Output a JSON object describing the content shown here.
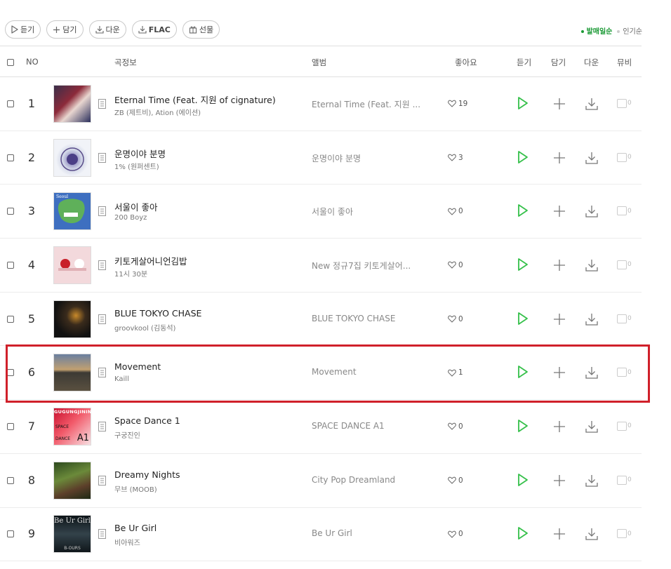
{
  "toolbar": {
    "listen_label": "듣기",
    "add_label": "담기",
    "download_label": "다운",
    "flac_label": "FLAC",
    "gift_label": "선물"
  },
  "sort": {
    "release_label": "발매일순",
    "popular_label": "인기순",
    "active_color": "#1c9a36"
  },
  "header": {
    "no": "NO",
    "song_info": "곡정보",
    "album": "앨범",
    "likes": "좋아요",
    "listen": "듣기",
    "add": "담기",
    "download": "다운",
    "mv": "뮤비"
  },
  "mv_count_label": "0",
  "songs": [
    {
      "no": "1",
      "title": "Eternal Time (Feat. 지원 of cignature)",
      "artist": "ZB (제트비), Ation (에이션)",
      "album": "Eternal Time (Feat. 지원 ...",
      "likes": "19"
    },
    {
      "no": "2",
      "title": "운명이야 분명",
      "artist": "1% (원퍼센트)",
      "album": "운명이야 분명",
      "likes": "3"
    },
    {
      "no": "3",
      "title": "서울이 좋아",
      "artist": "200 Boyz",
      "album": "서울이 좋아",
      "likes": "0"
    },
    {
      "no": "4",
      "title": "키토게살어니언김밥",
      "artist": "11시 30분",
      "album": "New 정규7집 키토게살어...",
      "likes": "0"
    },
    {
      "no": "5",
      "title": "BLUE TOKYO CHASE",
      "artist": "groovkool (김동석)",
      "album": "BLUE TOKYO CHASE",
      "likes": "0"
    },
    {
      "no": "6",
      "title": "Movement",
      "artist": "Kaill",
      "album": "Movement",
      "likes": "1"
    },
    {
      "no": "7",
      "title": "Space Dance 1",
      "artist": "구궁진인",
      "album": "SPACE DANCE A1",
      "likes": "0"
    },
    {
      "no": "8",
      "title": "Dreamy Nights",
      "artist": "무브 (MOOB)",
      "album": "City Pop Dreamland",
      "likes": "0"
    },
    {
      "no": "9",
      "title": "Be Ur Girl",
      "artist": "비아워즈",
      "album": "Be Ur Girl",
      "likes": "0"
    }
  ],
  "thumb_text": {
    "row7_top": "GUGUNGJININ",
    "row7_mid1": "SPACE",
    "row7_mid2": "DANCE",
    "row7_big": "A1",
    "row9_title": "Be Ur Girl",
    "row9_bottom": "B-OURS",
    "row3_label": "Seoul"
  },
  "colors": {
    "play_green": "#35c04a",
    "highlight_red": "#d0202a"
  }
}
